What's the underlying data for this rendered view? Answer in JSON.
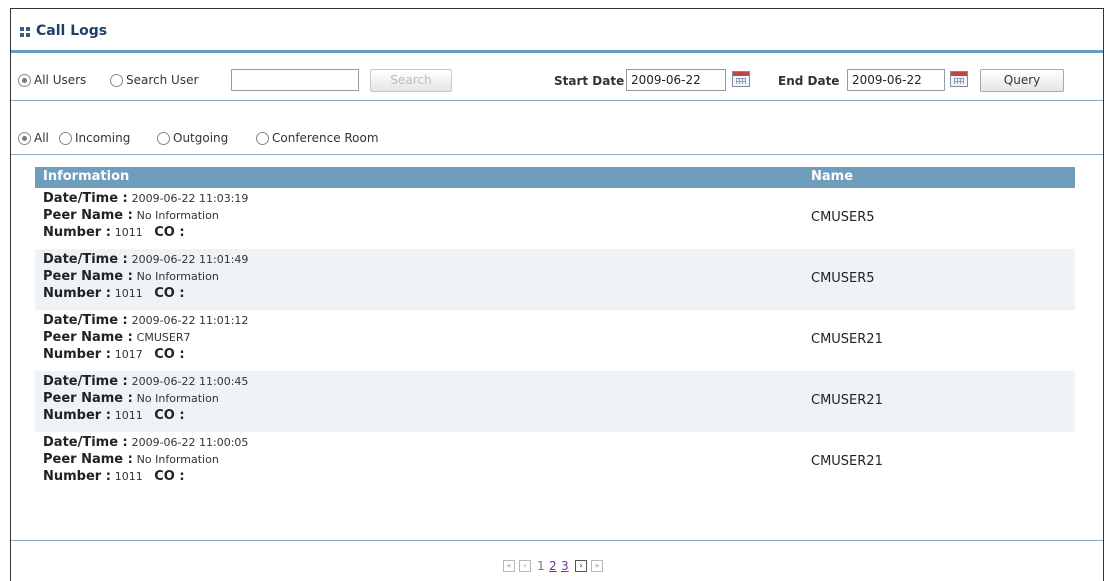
{
  "header": {
    "title": "Call Logs"
  },
  "filters": {
    "all_users_label": "All Users",
    "search_user_label": "Search User",
    "search_value": "",
    "search_button_label": "Search",
    "start_date_label": "Start Date",
    "start_date_value": "2009-06-22",
    "end_date_label": "End Date",
    "end_date_value": "2009-06-22",
    "query_button_label": "Query"
  },
  "call_types": [
    "All",
    "Incoming",
    "Outgoing",
    "Conference Room"
  ],
  "table": {
    "headers": [
      "Information",
      "Name"
    ],
    "field_labels": {
      "datetime": "Date/Time :",
      "peer": "Peer Name :",
      "number": "Number :",
      "co": "CO :"
    },
    "rows": [
      {
        "datetime": "2009-06-22 11:03:19",
        "peer": "No Information",
        "number": "1011",
        "name": "CMUSER5"
      },
      {
        "datetime": "2009-06-22 11:01:49",
        "peer": "No Information",
        "number": "1011",
        "name": "CMUSER5"
      },
      {
        "datetime": "2009-06-22 11:01:12",
        "peer": "CMUSER7",
        "number": "1017",
        "name": "CMUSER21"
      },
      {
        "datetime": "2009-06-22 11:00:45",
        "peer": "No Information",
        "number": "1011",
        "name": "CMUSER21"
      },
      {
        "datetime": "2009-06-22 11:00:05",
        "peer": "No Information",
        "number": "1011",
        "name": "CMUSER21"
      }
    ]
  },
  "pagination": {
    "first_icon": "double-chevron-left-icon",
    "prev_icon": "chevron-left-icon",
    "next_icon": "chevron-right-icon",
    "last_icon": "double-chevron-right-icon",
    "pages": [
      "1",
      "2",
      "3"
    ],
    "current_page": "1"
  }
}
